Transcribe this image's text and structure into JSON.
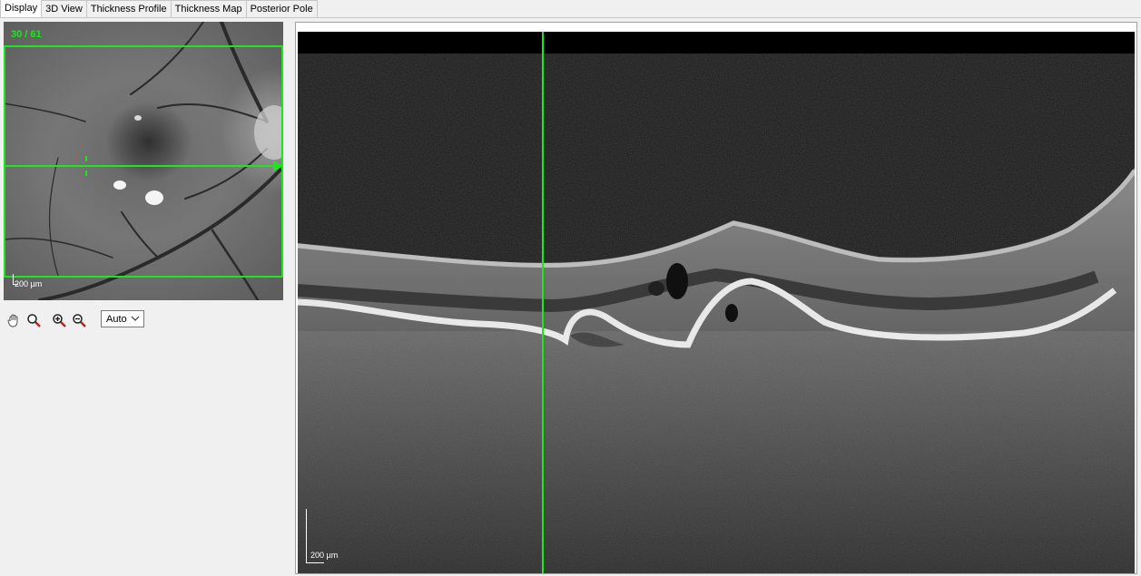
{
  "tabs": [
    {
      "label": "Display",
      "active": true
    },
    {
      "label": "3D View",
      "active": false
    },
    {
      "label": "Thickness Profile",
      "active": false
    },
    {
      "label": "Thickness Map",
      "active": false
    },
    {
      "label": "Posterior Pole",
      "active": false
    }
  ],
  "fundus": {
    "scan_counter": "30 / 61",
    "scale_label": "200 µm"
  },
  "toolbar": {
    "zoom_mode": "Auto",
    "icons": [
      "hand-pan-icon",
      "magnifier-icon",
      "zoom-in-icon",
      "zoom-out-icon"
    ]
  },
  "oct": {
    "scale_label": "200 µm"
  },
  "colors": {
    "accent_green": "#1ee61e",
    "background": "#f0f0f0"
  }
}
